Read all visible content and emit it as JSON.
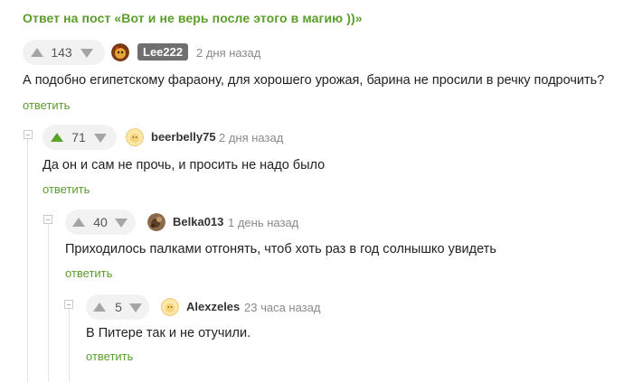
{
  "post_link": "Ответ на пост «Вот и не верь после этого в магию ))»",
  "reply_label": "ответить",
  "comments": [
    {
      "score": "143",
      "user": "Lee222",
      "time": "2 дня назад",
      "text": "А подобно египетскому фараону, для хорошего урожая, барина не просили в речку подрочить?",
      "upvoted": false
    },
    {
      "score": "71",
      "user": "beerbelly75",
      "time": "2 дня назад",
      "text": "Да он и сам не прочь, и просить не надо было",
      "upvoted": true
    },
    {
      "score": "40",
      "user": "Belka013",
      "time": "1 день назад",
      "text": "Приходилось палками отгонять, чтоб хоть раз в год солнышко увидеть",
      "upvoted": false
    },
    {
      "score": "5",
      "user": "Alexzeles",
      "time": "23 часа назад",
      "text": "В Питере так и не отучили.",
      "upvoted": false
    }
  ],
  "colors": {
    "accent": "#5a9e2a",
    "badge_bg": "#6f6f6f"
  },
  "icons": {
    "upvote": "triangle-up-icon",
    "downvote": "triangle-down-icon",
    "collapse": "collapse-minus-icon"
  }
}
